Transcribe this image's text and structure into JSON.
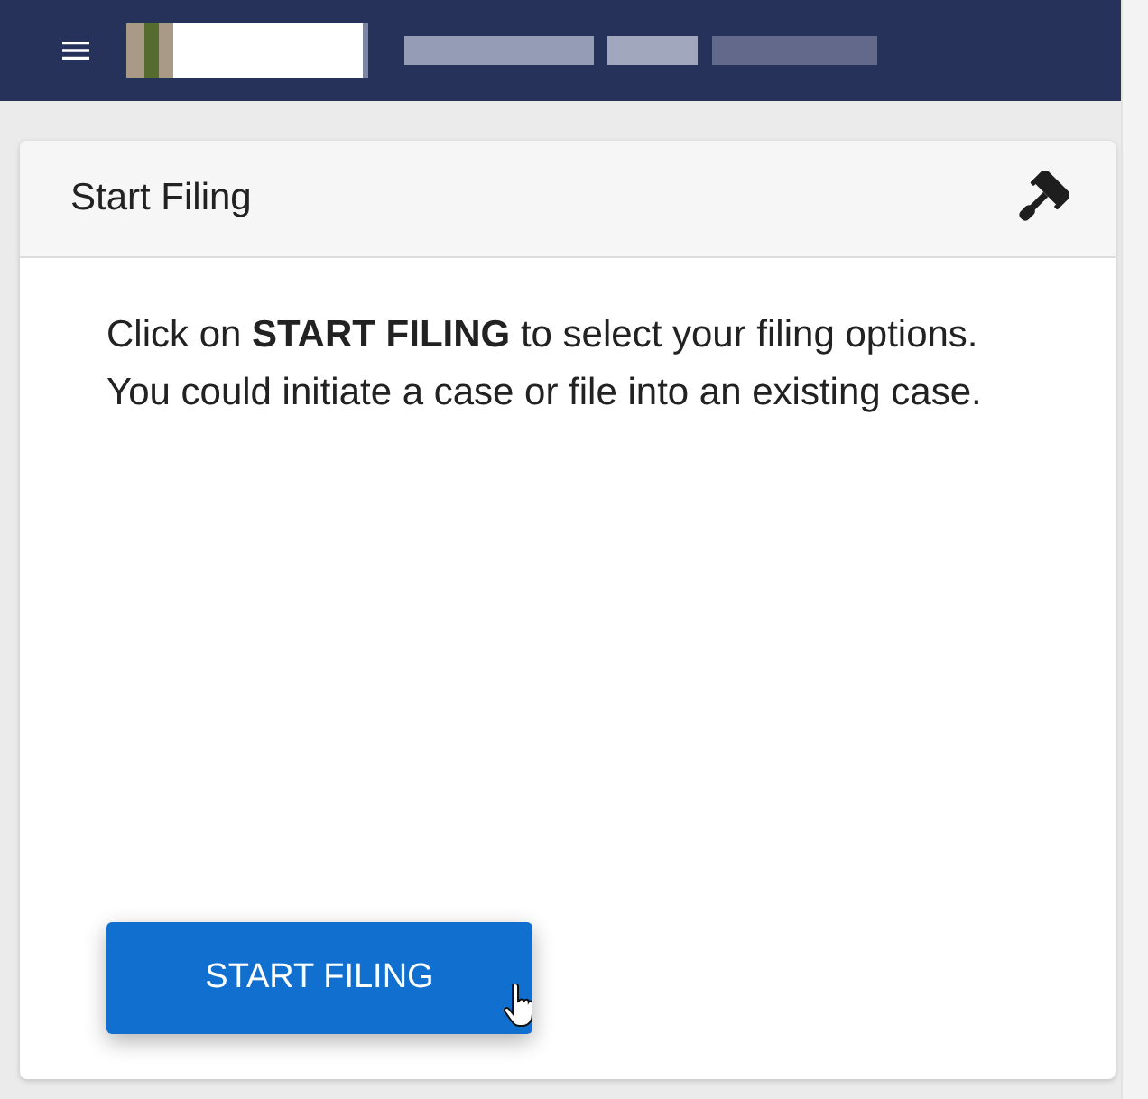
{
  "card": {
    "title": "Start Filing",
    "instructions": [
      "Click on **START FILING** to select your filing options.",
      "You could initiate a case or file into an existing case."
    ],
    "button": {
      "label": "START FILING"
    }
  }
}
